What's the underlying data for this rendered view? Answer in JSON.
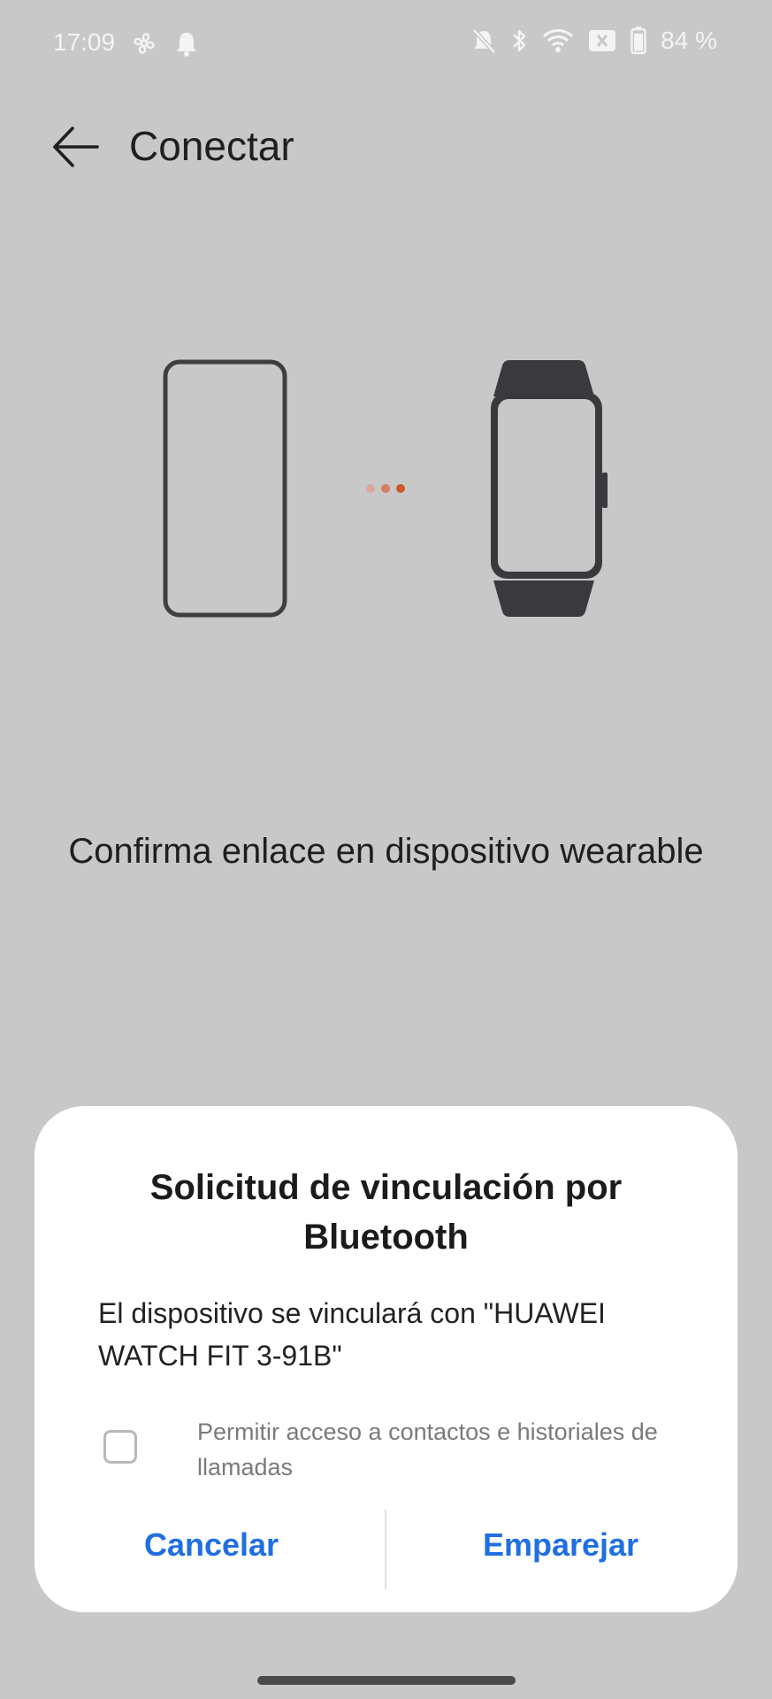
{
  "status_bar": {
    "time": "17:09",
    "battery_percent": "84 %",
    "left_icons": [
      "fan-icon",
      "bell-icon"
    ],
    "right_icons": [
      "bell-off-icon",
      "bluetooth-icon",
      "wifi-icon",
      "sim-x-icon",
      "battery-icon"
    ]
  },
  "app_bar": {
    "title": "Conectar"
  },
  "illustration": {
    "left": "phone-outline-icon",
    "right": "fitness-band-icon",
    "dot_colors": [
      "#d9a896",
      "#d47f5e",
      "#c85a2a"
    ]
  },
  "main": {
    "message": "Confirma enlace en dispositivo wearable"
  },
  "dialog": {
    "title": "Solicitud de vinculación por Bluetooth",
    "message": "El dispositivo se vinculará con \"HUAWEI WATCH FIT 3-91B\"",
    "permission": {
      "label": "Permitir acceso a contactos e historiales de llamadas",
      "checked": false
    },
    "cancel_label": "Cancelar",
    "pair_label": "Emparejar",
    "accent_color": "#1f6fe0"
  }
}
